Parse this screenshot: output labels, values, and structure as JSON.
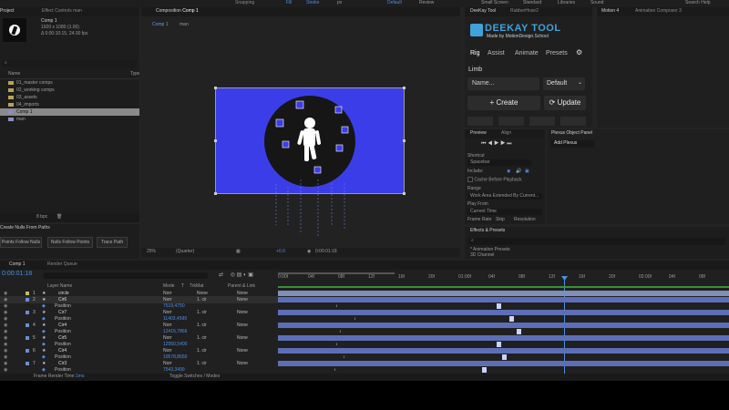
{
  "top": {
    "items": [
      "Snapping",
      "Fill",
      "Stroke",
      "px",
      "Default",
      "Review",
      "Small Screen",
      "Standard",
      "Libraries",
      "Sound",
      "Search Help"
    ]
  },
  "project": {
    "tabs": [
      "Project",
      "Effect Controls man"
    ],
    "comp_name": "Comp 1",
    "comp_info_1": "1920 x 1080 (1.00)",
    "comp_info_2": "Δ 0:00:10:15, 24.00 fps",
    "col_name": "Name",
    "col_type": "Type",
    "items": [
      {
        "name": "01_master comps",
        "type": "folder"
      },
      {
        "name": "02_working comps",
        "type": "folder"
      },
      {
        "name": "03_assets",
        "type": "folder"
      },
      {
        "name": "04_imports",
        "type": "folder"
      },
      {
        "name": "Comp 1",
        "type": "comp"
      },
      {
        "name": "man",
        "type": "comp"
      }
    ],
    "bpc": "8 bpc"
  },
  "nulls": {
    "title": "Create Nulls From Paths",
    "buttons": [
      "Points Follow Nulls",
      "Nulls Follow Points",
      "Trace Path"
    ]
  },
  "composition": {
    "tab_title": "Composition",
    "tab_comp": "Comp 1",
    "crumbs": [
      "Comp 1",
      "man"
    ],
    "zoom": "25%",
    "quality": "(Quarter)",
    "exposure": "+0.0",
    "timecode": "0:00:01:18"
  },
  "deekay": {
    "tabs": [
      "DeeKay Tool",
      "RubberHose2"
    ],
    "logo": "DEEKAY TOOL",
    "made_by": "Made by MotionDesign.School",
    "nav": [
      "Rig",
      "Assist",
      "Animate",
      "Presets"
    ],
    "section": "Limb",
    "name_placeholder": "Name...",
    "preset": "Default",
    "create": "Create",
    "update": "Update"
  },
  "motion4": {
    "tabs": [
      "Motion 4",
      "Animation Composer 3"
    ]
  },
  "preview": {
    "tabs": [
      "Preview",
      "Align"
    ],
    "shortcut_label": "Shortcut",
    "shortcut": "Spacebar",
    "include_label": "Include:",
    "cache_label": "Cache Before Playback",
    "range_label": "Range",
    "range": "Work Area Extended By Current...",
    "play_from_label": "Play From",
    "play_from": "Current Time",
    "bottom": [
      "Frame Rate",
      "Skip",
      "Resolution"
    ]
  },
  "plexus": {
    "title": "Plexus Object Panel",
    "add": "Add Plexus"
  },
  "effects": {
    "title": "Effects & Presets",
    "items": [
      "* Animation Presets",
      "3D Channel"
    ]
  },
  "timeline": {
    "tabs": [
      "Comp 1",
      "Render Queue"
    ],
    "timecode": "0:00:01:18",
    "ruler": [
      "0:00f",
      "04f",
      "08f",
      "12f",
      "16f",
      "20f",
      "01:00f",
      "04f",
      "08f",
      "12f",
      "16f",
      "20f",
      "02:00f",
      "04f",
      "08f"
    ],
    "cols": [
      "Layer Name",
      "Mode",
      "T",
      "TrkMat",
      "Parent & Link"
    ],
    "layers": [
      {
        "num": "1",
        "name": "circle",
        "mode": "Norr",
        "trk": "None",
        "parent": "None",
        "kind": "layer",
        "color": "#c0c05a"
      },
      {
        "num": "2",
        "name": "Cir6",
        "mode": "Norr",
        "trk": "1. cir",
        "parent": "None",
        "kind": "layer",
        "color": "#6a8fd0"
      },
      {
        "num": "",
        "name": "Position",
        "value": "7519,4750",
        "kind": "prop"
      },
      {
        "num": "3",
        "name": "Cir7",
        "mode": "Norr",
        "trk": "1. cir",
        "parent": "None",
        "kind": "layer",
        "color": "#6a8fd0"
      },
      {
        "num": "",
        "name": "Position",
        "value": "11403,4599",
        "kind": "prop"
      },
      {
        "num": "4",
        "name": "Cir4",
        "mode": "Norr",
        "trk": "1. cir",
        "parent": "None",
        "kind": "layer",
        "color": "#6a8fd0"
      },
      {
        "num": "",
        "name": "Position",
        "value": "12415,7866",
        "kind": "prop"
      },
      {
        "num": "5",
        "name": "Cir5",
        "mode": "Norr",
        "trk": "1. cir",
        "parent": "None",
        "kind": "layer",
        "color": "#6a8fd0"
      },
      {
        "num": "",
        "name": "Position",
        "value": "12950,5400",
        "kind": "prop"
      },
      {
        "num": "6",
        "name": "Cir4",
        "mode": "Norr",
        "trk": "1. cir",
        "parent": "None",
        "kind": "layer",
        "color": "#6a8fd0"
      },
      {
        "num": "",
        "name": "Position",
        "value": "10578,8650",
        "kind": "prop"
      },
      {
        "num": "7",
        "name": "Cir3",
        "mode": "Norr",
        "trk": "1. cir",
        "parent": "None",
        "kind": "layer",
        "color": "#6a8fd0"
      },
      {
        "num": "",
        "name": "Position",
        "value": "7543,3499",
        "kind": "prop"
      }
    ],
    "footer_left": "Frame Render Time:",
    "footer_time": "1ms",
    "footer_mid": "Toggle Switches / Modes"
  }
}
